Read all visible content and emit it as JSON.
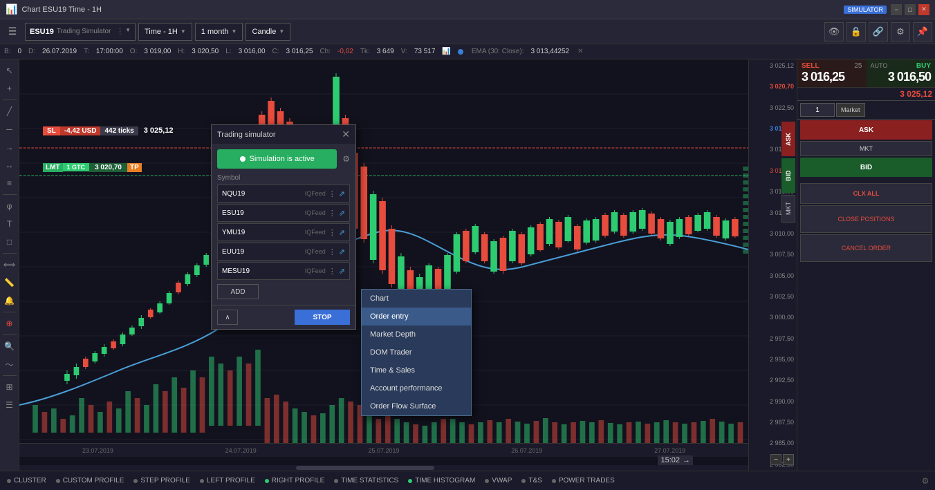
{
  "titlebar": {
    "title": "Chart ESU19 Time - 1H",
    "badge": "SIMULATOR",
    "min_label": "−",
    "max_label": "□",
    "close_label": "✕"
  },
  "toolbar": {
    "symbol": "ESU19",
    "symbol_sub": "Trading Simulator",
    "period": "Time - 1H",
    "range": "1 month",
    "chart_type": "Candle"
  },
  "infobar": {
    "b_label": "B:",
    "b_val": "0",
    "d_label": "D:",
    "d_val": "26.07.2019",
    "t_label": "T:",
    "t_val": "17:00:00",
    "o_label": "O:",
    "o_val": "3 019,00",
    "h_label": "H:",
    "h_val": "3 020,50",
    "l_label": "L:",
    "l_val": "3 016,00",
    "c_label": "C:",
    "c_val": "3 016,25",
    "ch_label": "Ch:",
    "ch_val": "-0,02",
    "tk_label": "Tk:",
    "tk_val": "3 649",
    "v_label": "V:",
    "v_val": "73 517",
    "ema_label": "EMA (30: Close):",
    "ema_val": "3 013,44252"
  },
  "order_labels": {
    "sl_type": "SL",
    "sl_pnl": "-4,42 USD",
    "sl_ticks": "442 ticks",
    "sl_price": "3 025,12",
    "lmt_type": "LMT",
    "lmt_qty": "1 GTC",
    "lmt_price": "3 020,70",
    "lmt_tp": "TP"
  },
  "right_panel": {
    "sell_label": "SELL",
    "sell_qty": "25",
    "buy_label": "BUY",
    "auto_label": "AUTO",
    "sell_price": "3 016,25",
    "buy_price": "3 016,50",
    "sidebar_price": "3 025,12",
    "qty": "1",
    "market": "Market",
    "ask_label": "ASK",
    "bid_label": "BID",
    "mkt_label": "MKT",
    "clx_label": "CLX ALL",
    "close_positions_label": "CLOSE POSITIONS",
    "cancel_order_label": "CANCEL ORDER"
  },
  "price_levels": [
    "3 022,50",
    "3 020,00",
    "3 017,50",
    "3 015,00",
    "3 012,50",
    "3 010,00",
    "3 007,50",
    "3 005,00",
    "3 002,50",
    "3 000,00",
    "2 997,50",
    "2 995,00",
    "2 992,50",
    "2 990,00",
    "2 987,50",
    "2 985,00",
    "2 982,50"
  ],
  "trading_sim": {
    "title": "Trading simulator",
    "active_label": "Simulation is active",
    "symbol_label": "Symbol",
    "symbols": [
      {
        "name": "NQU19",
        "feed": "IQFeed"
      },
      {
        "name": "ESU19",
        "feed": "IQFeed"
      },
      {
        "name": "YMU19",
        "feed": "IQFeed"
      },
      {
        "name": "EUU19",
        "feed": "IQFeed"
      },
      {
        "name": "MESU19",
        "feed": "IQFeed"
      }
    ],
    "add_label": "ADD",
    "up_label": "∧",
    "stop_label": "STOP"
  },
  "context_menu": {
    "items": [
      {
        "label": "Chart",
        "active": false
      },
      {
        "label": "Order entry",
        "active": true
      },
      {
        "label": "Market Depth",
        "active": false
      },
      {
        "label": "DOM Trader",
        "active": false
      },
      {
        "label": "Time & Sales",
        "active": false
      },
      {
        "label": "Account performance",
        "active": false
      },
      {
        "label": "Order Flow Surface",
        "active": false
      }
    ]
  },
  "time_labels": [
    "23.07.2019",
    "24.07.2019",
    "25.07.2019",
    "26.07.2019",
    "27.07.2019"
  ],
  "timestamp": "15:02",
  "bottom_tabs": [
    {
      "label": "CLUSTER",
      "dot": "gray",
      "active": false
    },
    {
      "label": "CUSTOM PROFILE",
      "dot": "gray",
      "active": false
    },
    {
      "label": "STEP PROFILE",
      "dot": "gray",
      "active": false
    },
    {
      "label": "LEFT PROFILE",
      "dot": "gray",
      "active": false
    },
    {
      "label": "RIGHT PROFILE",
      "dot": "green",
      "active": false
    },
    {
      "label": "TIME STATISTICS",
      "dot": "gray",
      "active": false
    },
    {
      "label": "TIME HISTOGRAM",
      "dot": "green",
      "active": false
    },
    {
      "label": "VWAP",
      "dot": "gray",
      "active": false
    },
    {
      "label": "T&S",
      "dot": "gray",
      "active": false
    },
    {
      "label": "POWER TRADES",
      "dot": "gray",
      "active": false
    }
  ]
}
